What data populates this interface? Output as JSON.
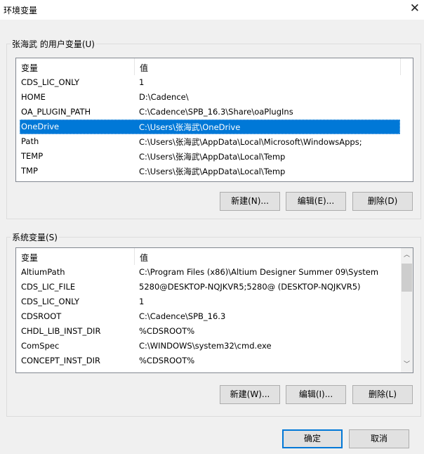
{
  "window": {
    "title": "环境变量",
    "close": "✕"
  },
  "user": {
    "label": "张海武 的用户变量(U)",
    "col1": "变量",
    "col2": "值",
    "rows": [
      {
        "name": "CDS_LIC_ONLY",
        "value": "1"
      },
      {
        "name": "HOME",
        "value": "D:\\Cadence\\"
      },
      {
        "name": "OA_PLUGIN_PATH",
        "value": "C:\\Cadence\\SPB_16.3\\Share\\oaPlugIns"
      },
      {
        "name": "OneDrive",
        "value": "C:\\Users\\张海武\\OneDrive"
      },
      {
        "name": "Path",
        "value": "C:\\Users\\张海武\\AppData\\Local\\Microsoft\\WindowsApps;"
      },
      {
        "name": "TEMP",
        "value": "C:\\Users\\张海武\\AppData\\Local\\Temp"
      },
      {
        "name": "TMP",
        "value": "C:\\Users\\张海武\\AppData\\Local\\Temp"
      }
    ],
    "new": "新建(N)...",
    "edit": "编辑(E)...",
    "delete": "删除(D)"
  },
  "system": {
    "label": "系统变量(S)",
    "col1": "变量",
    "col2": "值",
    "rows": [
      {
        "name": "AltiumPath",
        "value": "C:\\Program Files (x86)\\Altium Designer Summer 09\\System"
      },
      {
        "name": "CDS_LIC_FILE",
        "value": "5280@DESKTOP-NQJKVR5;5280@  (DESKTOP-NQJKVR5)"
      },
      {
        "name": "CDS_LIC_ONLY",
        "value": "1"
      },
      {
        "name": "CDSROOT",
        "value": "C:\\Cadence\\SPB_16.3"
      },
      {
        "name": "CHDL_LIB_INST_DIR",
        "value": "%CDSROOT%"
      },
      {
        "name": "ComSpec",
        "value": "C:\\WINDOWS\\system32\\cmd.exe"
      },
      {
        "name": "CONCEPT_INST_DIR",
        "value": "%CDSROOT%"
      }
    ],
    "new": "新建(W)...",
    "edit": "编辑(I)...",
    "delete": "删除(L)"
  },
  "ok": "确定",
  "cancel": "取消"
}
